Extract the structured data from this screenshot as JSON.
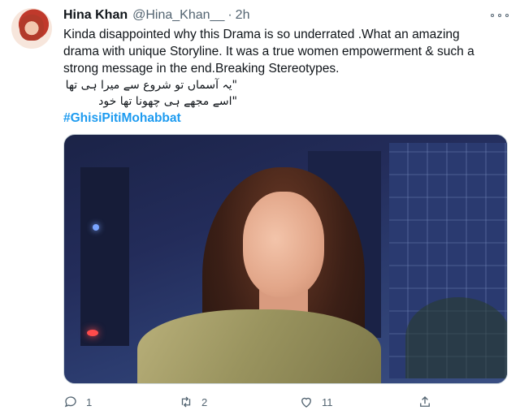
{
  "tweet": {
    "author_name": "Hina Khan",
    "handle": "@Hina_Khan__",
    "separator": "·",
    "time": "2h",
    "text_line1": "Kinda disappointed why this Drama is so underrated .What an amazing",
    "text_line2": "drama with unique Storyline. It was a true women empowerment & such a",
    "text_line3": "strong message in the end.Breaking Stereotypes.",
    "urdu_line1": "\"یہ آسماں تو شروع سے میرا ہی تھا",
    "urdu_line2": "\"اسے مجھے ہی چھونا تھا خود",
    "hashtag": "#GhisiPitiMohabbat"
  },
  "actions": {
    "reply_count": "1",
    "retweet_count": "2",
    "like_count": "11"
  },
  "icons": [
    "more-icon",
    "reply-icon",
    "retweet-icon",
    "like-icon",
    "share-icon"
  ],
  "colors": {
    "link": "#1d9bf0",
    "muted": "#536471",
    "text": "#0f1419"
  }
}
